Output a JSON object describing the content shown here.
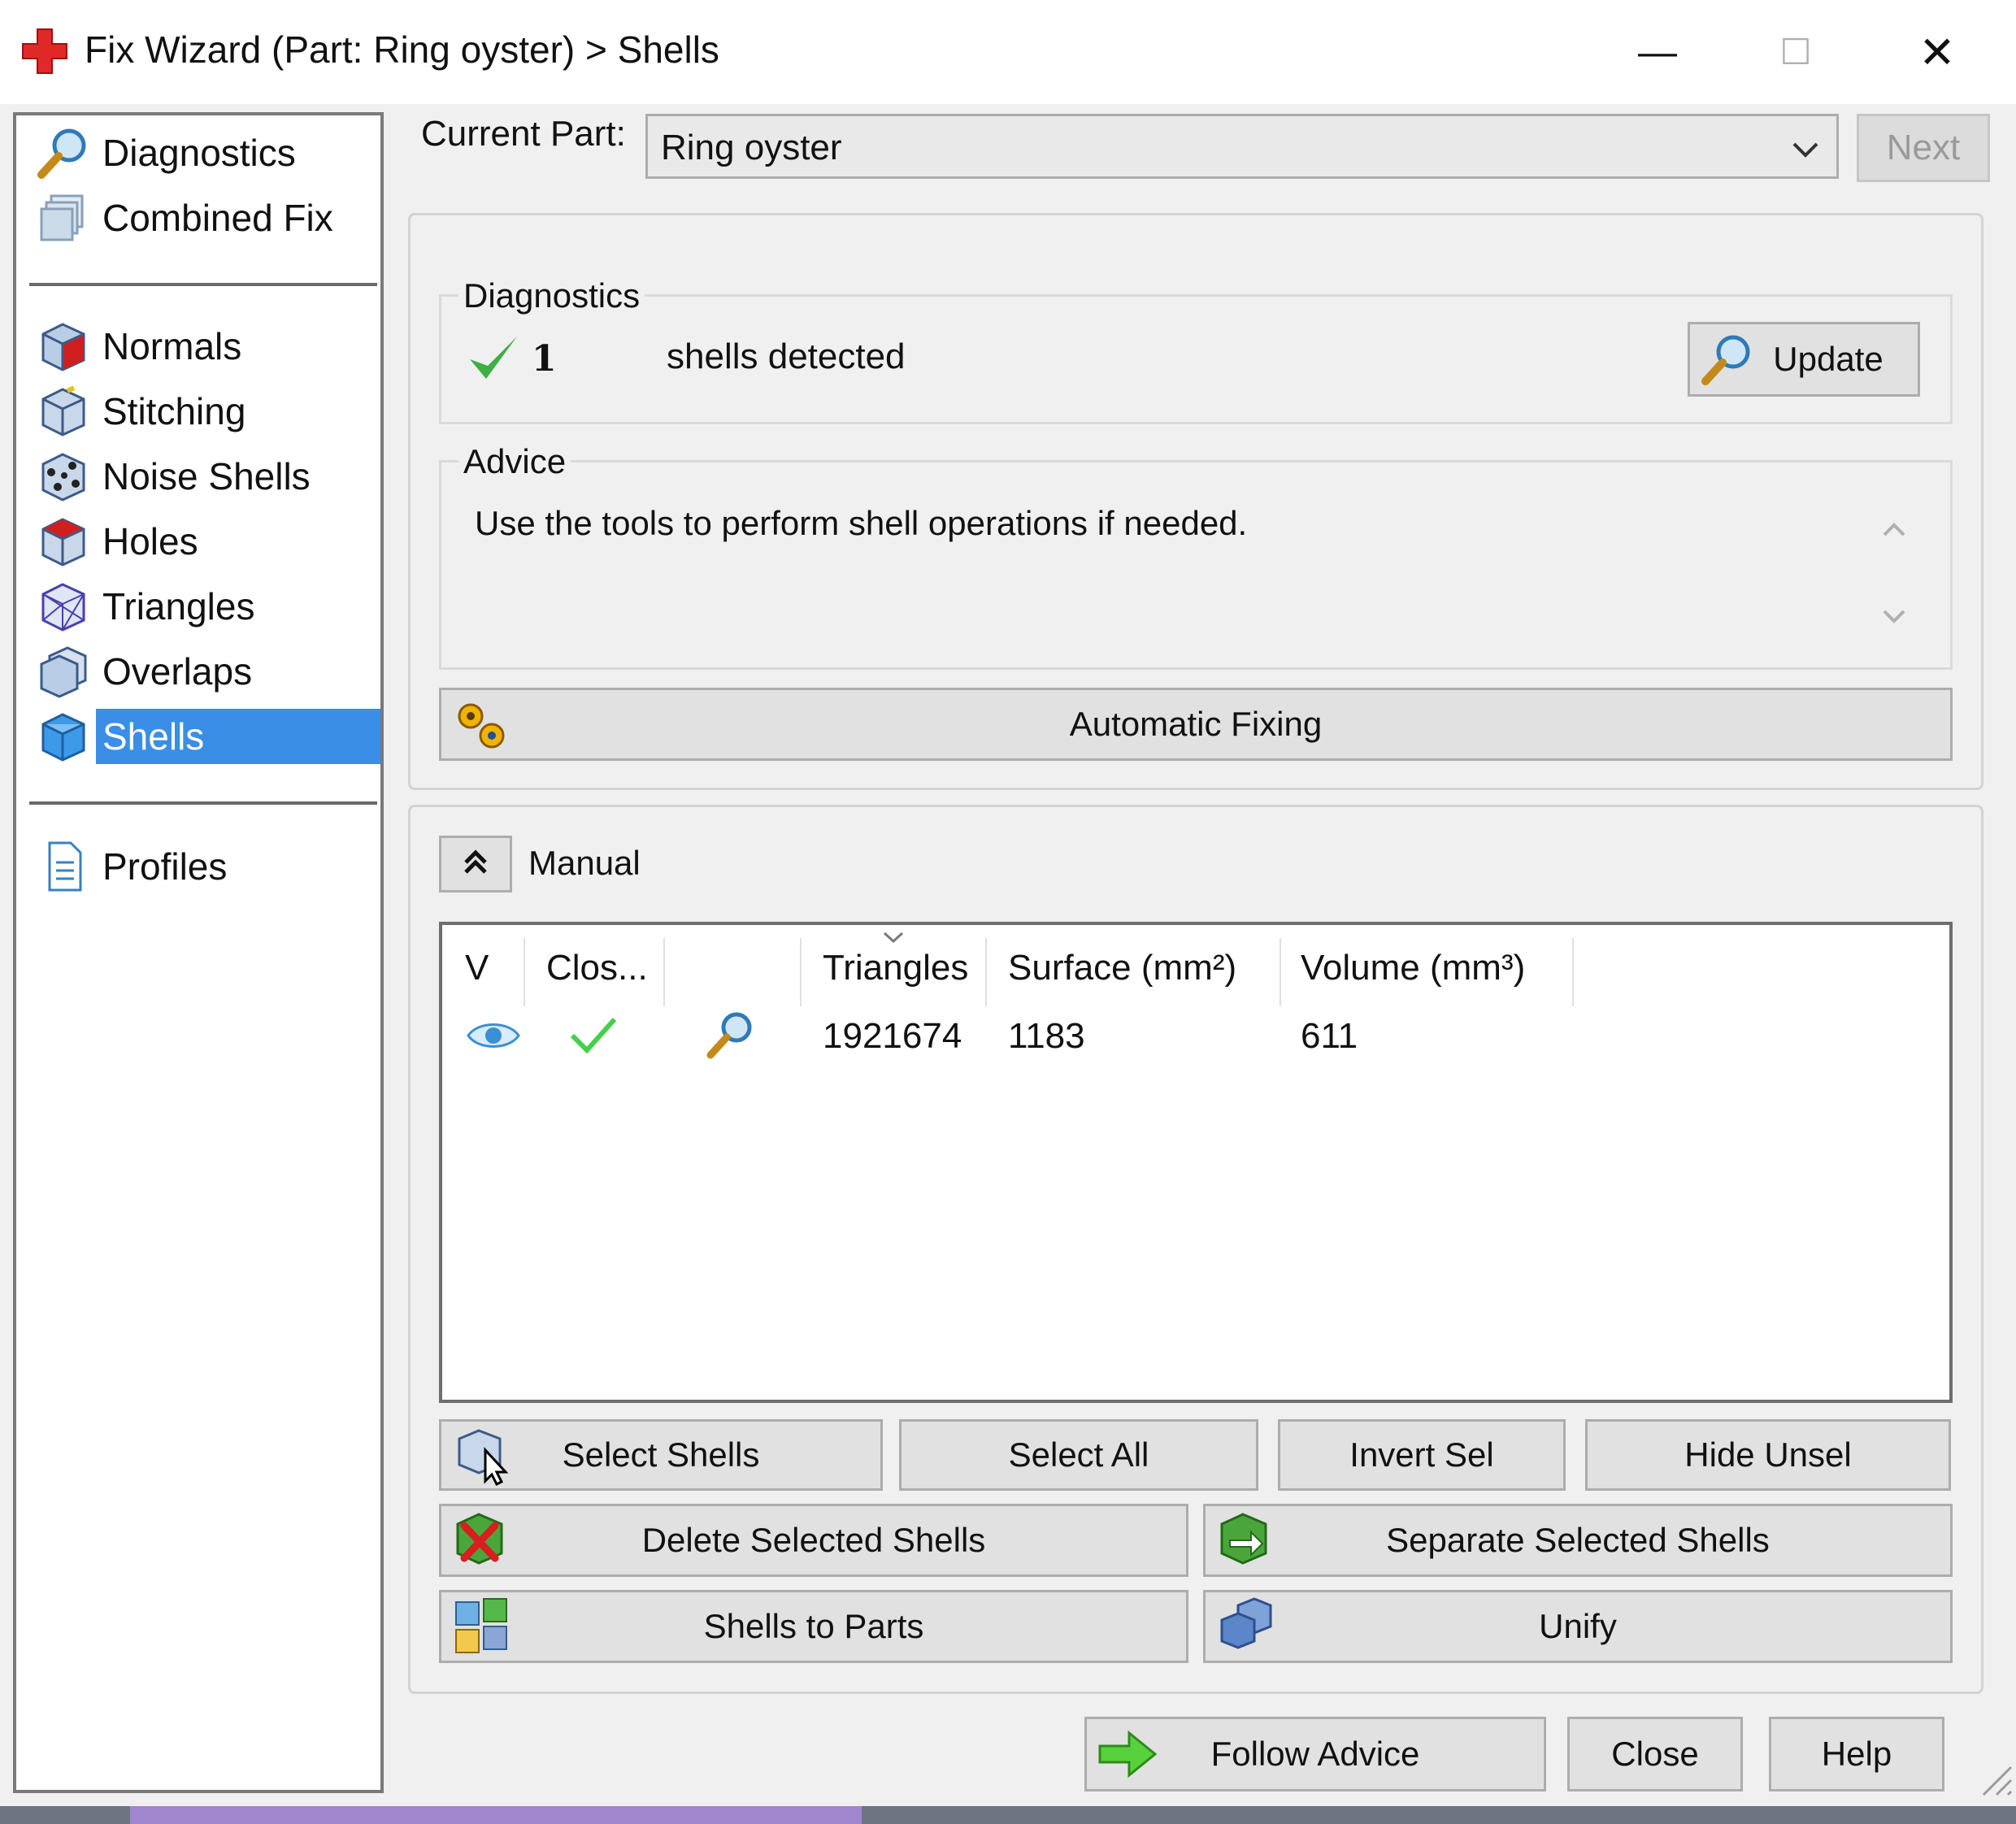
{
  "window": {
    "title": "Fix Wizard (Part: Ring oyster) > Shells",
    "controls": {
      "minimize": "—",
      "maximize": "☐",
      "close": "✕"
    }
  },
  "nav": {
    "top_items": [
      {
        "label": "Diagnostics",
        "icon": "magnifier-icon"
      },
      {
        "label": "Combined Fix",
        "icon": "stacked-boxes-icon"
      }
    ],
    "fix_items": [
      {
        "label": "Normals",
        "icon": "cube-red-icon"
      },
      {
        "label": "Stitching",
        "icon": "cube-stitch-icon"
      },
      {
        "label": "Noise Shells",
        "icon": "cube-dots-icon"
      },
      {
        "label": "Holes",
        "icon": "cube-hole-icon"
      },
      {
        "label": "Triangles",
        "icon": "cube-wire-icon"
      },
      {
        "label": "Overlaps",
        "icon": "cube-overlap-icon"
      },
      {
        "label": "Shells",
        "icon": "cube-blue-icon",
        "selected": true
      }
    ],
    "bottom_items": [
      {
        "label": "Profiles",
        "icon": "document-icon"
      }
    ]
  },
  "current_part": {
    "label": "Current Part:",
    "value": "Ring oyster"
  },
  "next_label": "Next",
  "diagnostics": {
    "legend": "Diagnostics",
    "count": "1",
    "text": "shells detected",
    "update_label": "Update"
  },
  "advice": {
    "legend": "Advice",
    "text": "Use the tools to perform shell operations if needed."
  },
  "automatic_fixing_label": "Automatic Fixing",
  "manual": {
    "toggle_glyph": "⌃",
    "label": "Manual",
    "columns": [
      "V",
      "Clos...",
      "",
      "Triangles",
      "Surface (mm²)",
      "Volume (mm³)"
    ],
    "rows": [
      {
        "triangles": "1921674",
        "surface": "1183",
        "volume": "611"
      }
    ]
  },
  "buttons": {
    "select_shells": "Select Shells",
    "select_all": "Select All",
    "invert_sel": "Invert Sel",
    "hide_unsel": "Hide Unsel",
    "delete_selected": "Delete Selected Shells",
    "separate_selected": "Separate Selected Shells",
    "shells_to_parts": "Shells to Parts",
    "unify": "Unify",
    "follow_advice": "Follow Advice",
    "close": "Close",
    "help": "Help"
  },
  "colors": {
    "selection": "#3a8ee6",
    "check_green": "#3cb043",
    "arrow_green": "#58d23c",
    "app_icon_red": "#e02828"
  }
}
